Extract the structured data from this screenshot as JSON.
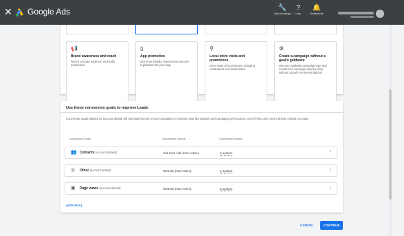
{
  "app": {
    "title": "Google Ads",
    "close_glyph": "✕",
    "brand_colors": {
      "blue": "#4285f4",
      "yellow": "#fbbc04",
      "green": "#34a853"
    }
  },
  "toolbar": {
    "tools": [
      {
        "icon": "wrench-icon",
        "glyph": "🔧",
        "label": "Tools & settings"
      },
      {
        "icon": "help-icon",
        "glyph": "?",
        "label": "Help"
      },
      {
        "icon": "bell-icon",
        "glyph": "🔔",
        "label": "Notifications"
      }
    ]
  },
  "campaign_types": [
    {
      "icon": "megaphone-icon",
      "glyph": "📢",
      "title": "Brand awareness and reach",
      "description": "Reach a broad audience and build awareness"
    },
    {
      "icon": "phone-icon",
      "glyph": "▯",
      "title": "App promotion",
      "description": "Get more installs, interactions and pre-registration for your app"
    },
    {
      "icon": "location-pin-icon",
      "glyph": "⚲",
      "title": "Local store visits and promotions",
      "description": "Drive visits to local stores, including restaurants and dealerships."
    },
    {
      "icon": "gear-icon",
      "glyph": "⚙",
      "title": "Create a campaign without a goal's guidance",
      "description": "Use any available campaign type and construct a campaign step-by-step without a goal's recommendations"
    }
  ],
  "goals": {
    "title": "Use these conversion goals to improve Leads",
    "description": "Conversion goals labeled as account default will use data from all of your campaigns to improve your bid strategy and campaign performance, even if they don't seem directly related to Leads.",
    "columns": [
      "Conversion Goals",
      "Conversion Source",
      "Conversion Actions"
    ],
    "rows": [
      {
        "icon": "contacts-icon",
        "glyph": "👥",
        "name": "Contacts",
        "sub": "(account default)",
        "source": "Call from Ads (Not Active)",
        "actions": "2 actions",
        "more": "⋮"
      },
      {
        "icon": "other-goal-icon",
        "glyph": "◎",
        "name": "Other",
        "sub": "(account default)",
        "source": "Website (Not Active)",
        "actions": "4 actions",
        "more": "⋮"
      },
      {
        "icon": "page-views-icon",
        "glyph": "▣",
        "name": "Page views",
        "sub": "(account default)",
        "source": "Website (Not Active)",
        "actions": "5 actions",
        "more": "⋮"
      }
    ],
    "add_goal_label": "ADD GOAL"
  },
  "footer": {
    "cancel_label": "CANCEL",
    "continue_label": "CONTINUE"
  }
}
